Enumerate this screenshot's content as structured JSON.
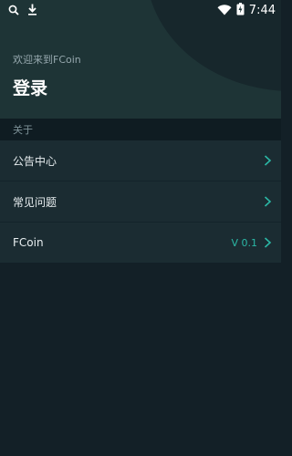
{
  "status_bar": {
    "time": "7:44",
    "icons": [
      "search-icon",
      "download-icon",
      "wifi-icon",
      "battery-charging-icon"
    ]
  },
  "header": {
    "welcome_text": "欢迎来到FCoin",
    "login_label": "登录"
  },
  "about_section": {
    "title": "关于",
    "items": [
      {
        "label": "公告中心",
        "value": ""
      },
      {
        "label": "常见问题",
        "value": ""
      },
      {
        "label": "FCoin",
        "value": "V 0.1"
      }
    ]
  },
  "colors": {
    "header_bg": "#1e3436",
    "page_bg": "#132027",
    "row_bg": "#1b2c32",
    "accent": "#2bb8a6"
  }
}
